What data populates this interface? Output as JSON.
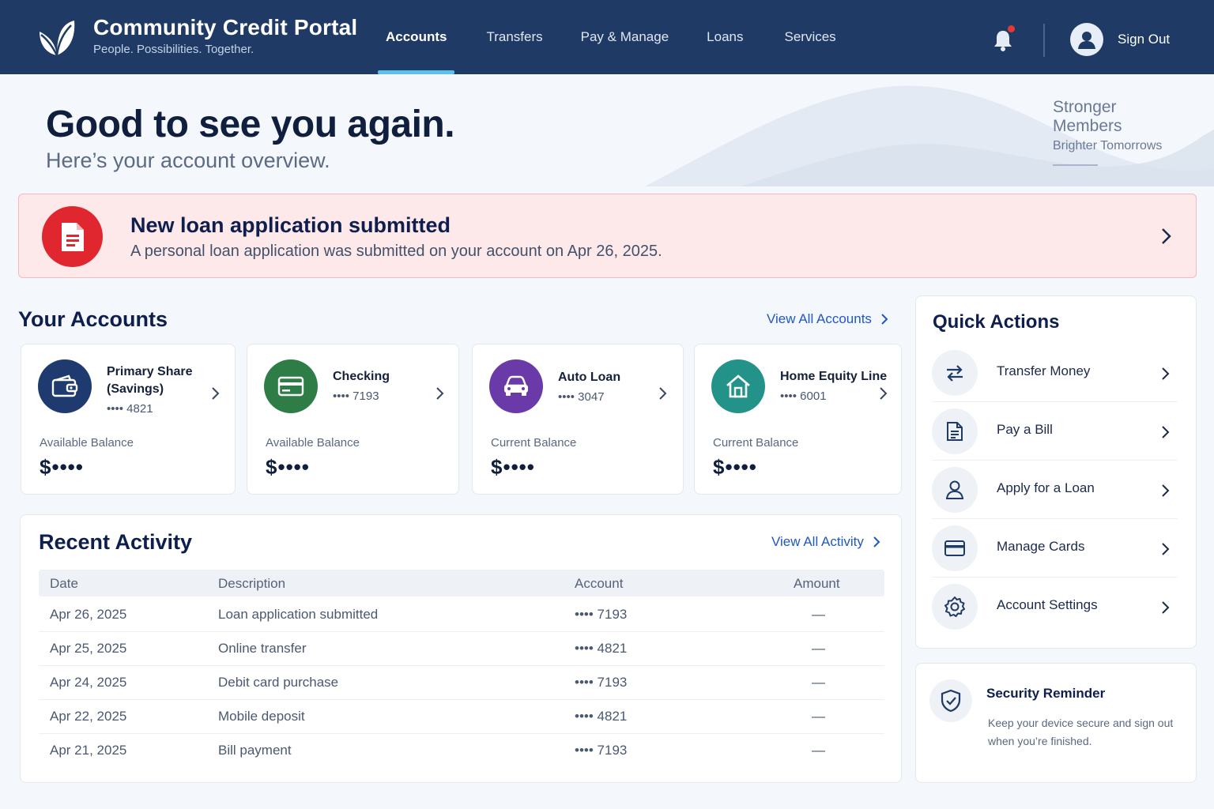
{
  "header": {
    "title": "Community Credit Portal",
    "tagline": "People. Possibilities. Together.",
    "nav": [
      {
        "label": "Accounts",
        "active": true
      },
      {
        "label": "Transfers",
        "active": false
      },
      {
        "label": "Pay & Manage",
        "active": false
      },
      {
        "label": "Loans",
        "active": false
      },
      {
        "label": "Services",
        "active": false
      }
    ],
    "sign_out": "Sign Out",
    "has_notification": true
  },
  "hero": {
    "greeting": "Good to see you again.",
    "subtitle": "Here’s your account overview.",
    "slogan_1": "Stronger",
    "slogan_2": "Members",
    "slogan_3": "Brighter Tomorrows"
  },
  "alert": {
    "title": "New loan application submitted",
    "text": "A personal loan application was submitted on your account on Apr 26, 2025."
  },
  "accounts": {
    "title": "Your Accounts",
    "view_all": "View All Accounts",
    "items": [
      {
        "name_1": "Primary Share",
        "name_2": "(Savings)",
        "number": "•••• 4821",
        "balance_label": "Available Balance",
        "balance": "$••••",
        "icon": "wallet-icon",
        "color": "#1f3a6e"
      },
      {
        "name_1": "Checking",
        "name_2": "",
        "number": "•••• 7193",
        "balance_label": "Available Balance",
        "balance": "$••••",
        "icon": "card-icon",
        "color": "#2e7d46"
      },
      {
        "name_1": "Auto Loan",
        "name_2": "",
        "number": "•••• 3047",
        "balance_label": "Current Balance",
        "balance": "$••••",
        "icon": "car-icon",
        "color": "#6a3aa8"
      },
      {
        "name_1": "Home Equity Line",
        "name_2": "",
        "number": "•••• 6001",
        "balance_label": "Current Balance",
        "balance": "$••••",
        "icon": "house-icon",
        "color": "#23938a"
      }
    ]
  },
  "activity": {
    "title": "Recent Activity",
    "view_all": "View All Activity",
    "columns": [
      "Date",
      "Description",
      "Account",
      "Amount"
    ],
    "rows": [
      {
        "date": "Apr 26, 2025",
        "description": "Loan application submitted",
        "account": "•••• 7193",
        "amount": "—"
      },
      {
        "date": "Apr 25, 2025",
        "description": "Online transfer",
        "account": "•••• 4821",
        "amount": "—"
      },
      {
        "date": "Apr 24, 2025",
        "description": "Debit card purchase",
        "account": "•••• 7193",
        "amount": "—"
      },
      {
        "date": "Apr 22, 2025",
        "description": "Mobile deposit",
        "account": "•••• 4821",
        "amount": "—"
      },
      {
        "date": "Apr 21, 2025",
        "description": "Bill payment",
        "account": "•••• 7193",
        "amount": "—"
      }
    ]
  },
  "quick_actions": {
    "title": "Quick Actions",
    "items": [
      {
        "label": "Transfer Money",
        "icon": "transfer-icon"
      },
      {
        "label": "Pay a Bill",
        "icon": "document-icon"
      },
      {
        "label": "Apply for a Loan",
        "icon": "person-icon"
      },
      {
        "label": "Manage Cards",
        "icon": "card-icon"
      },
      {
        "label": "Account Settings",
        "icon": "gear-icon"
      }
    ]
  },
  "security": {
    "title": "Security Reminder",
    "text": "Keep your device secure and sign out when you’re finished."
  },
  "colors": {
    "header_bg": "#1f3a64",
    "accent": "#5bc0eb",
    "link": "#1f57c3",
    "alert_bg": "#fde9ea",
    "alert_icon": "#e0262f"
  }
}
